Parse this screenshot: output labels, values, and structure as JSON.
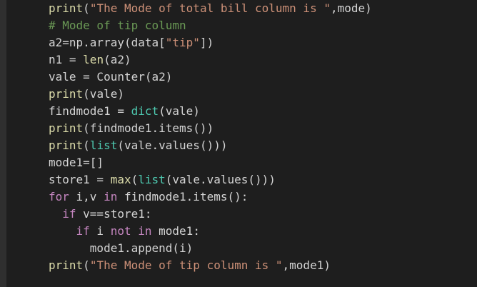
{
  "code_lines": [
    {
      "tokens": [
        {
          "t": "print",
          "c": "fn"
        },
        {
          "t": "(",
          "c": "punc"
        },
        {
          "t": "\"The Mode of total bill column is \"",
          "c": "str"
        },
        {
          "t": ",mode)",
          "c": "punc"
        }
      ]
    },
    {
      "tokens": [
        {
          "t": "# Mode of tip column",
          "c": "cm"
        }
      ]
    },
    {
      "tokens": [
        {
          "t": "a2=np.array(data[",
          "c": "var"
        },
        {
          "t": "\"tip\"",
          "c": "str"
        },
        {
          "t": "])",
          "c": "punc"
        }
      ]
    },
    {
      "tokens": [
        {
          "t": "n1 = ",
          "c": "var"
        },
        {
          "t": "len",
          "c": "fn"
        },
        {
          "t": "(a2)",
          "c": "punc"
        }
      ]
    },
    {
      "tokens": [
        {
          "t": "vale = Counter(a2)",
          "c": "var"
        }
      ]
    },
    {
      "tokens": [
        {
          "t": "print",
          "c": "fn"
        },
        {
          "t": "(vale)",
          "c": "punc"
        }
      ]
    },
    {
      "tokens": [
        {
          "t": "findmode1 = ",
          "c": "var"
        },
        {
          "t": "dict",
          "c": "bi"
        },
        {
          "t": "(vale)",
          "c": "punc"
        }
      ]
    },
    {
      "tokens": [
        {
          "t": "print",
          "c": "fn"
        },
        {
          "t": "(findmode1.items())",
          "c": "punc"
        }
      ]
    },
    {
      "tokens": [
        {
          "t": "print",
          "c": "fn"
        },
        {
          "t": "(",
          "c": "punc"
        },
        {
          "t": "list",
          "c": "bi"
        },
        {
          "t": "(vale.values()))",
          "c": "punc"
        }
      ]
    },
    {
      "tokens": [
        {
          "t": "mode1=[]",
          "c": "var"
        }
      ]
    },
    {
      "tokens": [
        {
          "t": "store1 = ",
          "c": "var"
        },
        {
          "t": "max",
          "c": "fn"
        },
        {
          "t": "(",
          "c": "punc"
        },
        {
          "t": "list",
          "c": "bi"
        },
        {
          "t": "(vale.values()))",
          "c": "punc"
        }
      ]
    },
    {
      "tokens": [
        {
          "t": "for",
          "c": "kw"
        },
        {
          "t": " i,v ",
          "c": "var"
        },
        {
          "t": "in",
          "c": "kw"
        },
        {
          "t": " findmode1.items():",
          "c": "var"
        }
      ]
    },
    {
      "tokens": [
        {
          "t": "  ",
          "c": "var"
        },
        {
          "t": "if",
          "c": "kw"
        },
        {
          "t": " v==store1:",
          "c": "var"
        }
      ]
    },
    {
      "tokens": [
        {
          "t": "    ",
          "c": "var"
        },
        {
          "t": "if",
          "c": "kw"
        },
        {
          "t": " i ",
          "c": "var"
        },
        {
          "t": "not",
          "c": "kw"
        },
        {
          "t": " ",
          "c": "var"
        },
        {
          "t": "in",
          "c": "kw"
        },
        {
          "t": " mode1:",
          "c": "var"
        }
      ]
    },
    {
      "tokens": [
        {
          "t": "      mode1.append(i)",
          "c": "var"
        }
      ]
    },
    {
      "tokens": [
        {
          "t": "print",
          "c": "fn"
        },
        {
          "t": "(",
          "c": "punc"
        },
        {
          "t": "\"The Mode of tip column is \"",
          "c": "str"
        },
        {
          "t": ",mode1)",
          "c": "punc"
        }
      ]
    }
  ]
}
